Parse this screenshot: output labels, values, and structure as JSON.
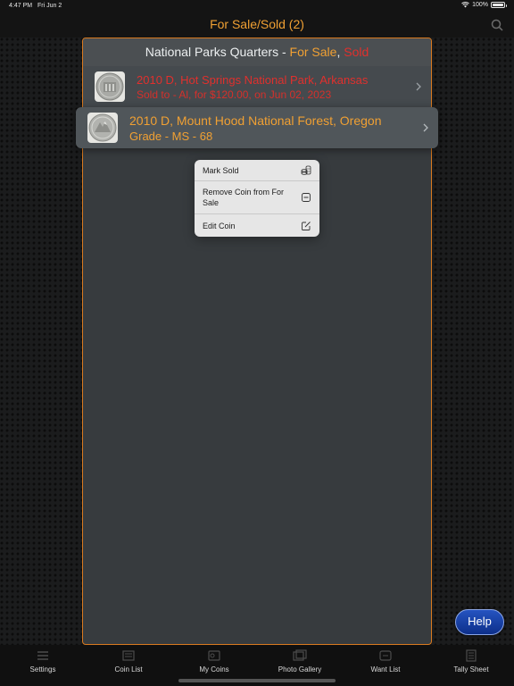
{
  "status": {
    "time": "4:47 PM",
    "date": "Fri Jun 2",
    "battery": "100%"
  },
  "nav": {
    "title": "For Sale/Sold (2)"
  },
  "panel": {
    "header_prefix": "National Parks Quarters - ",
    "header_sale": "For Sale",
    "header_sep": ", ",
    "header_sold": "Sold"
  },
  "coins": [
    {
      "title": "2010 D, Hot Springs National Park, Arkansas",
      "subtitle": "Sold to - Al, for $120.00, on Jun 02, 2023",
      "status": "sold",
      "color": "#e0302d"
    },
    {
      "title": "2010 D, Mount Hood National Forest, Oregon",
      "subtitle": "Grade - MS - 68",
      "status": "for-sale",
      "color": "#f0a033"
    }
  ],
  "menu": {
    "items": [
      {
        "label": "Mark Sold",
        "icon": "coins-stack-icon"
      },
      {
        "label": "Remove Coin from For Sale",
        "icon": "remove-square-icon"
      },
      {
        "label": "Edit Coin",
        "icon": "edit-square-icon"
      }
    ]
  },
  "help": {
    "label": "Help"
  },
  "tabs": [
    {
      "label": "Settings",
      "icon": "settings-icon"
    },
    {
      "label": "Coin List",
      "icon": "list-icon"
    },
    {
      "label": "My Coins",
      "icon": "coins-icon"
    },
    {
      "label": "Photo Gallery",
      "icon": "photo-gallery-icon"
    },
    {
      "label": "Want List",
      "icon": "want-list-icon"
    },
    {
      "label": "Tally Sheet",
      "icon": "tally-sheet-icon"
    }
  ],
  "colors": {
    "accent": "#f0a033",
    "sold": "#e0302d",
    "panel_border": "#d97a1f",
    "help": "#1f46b0"
  }
}
